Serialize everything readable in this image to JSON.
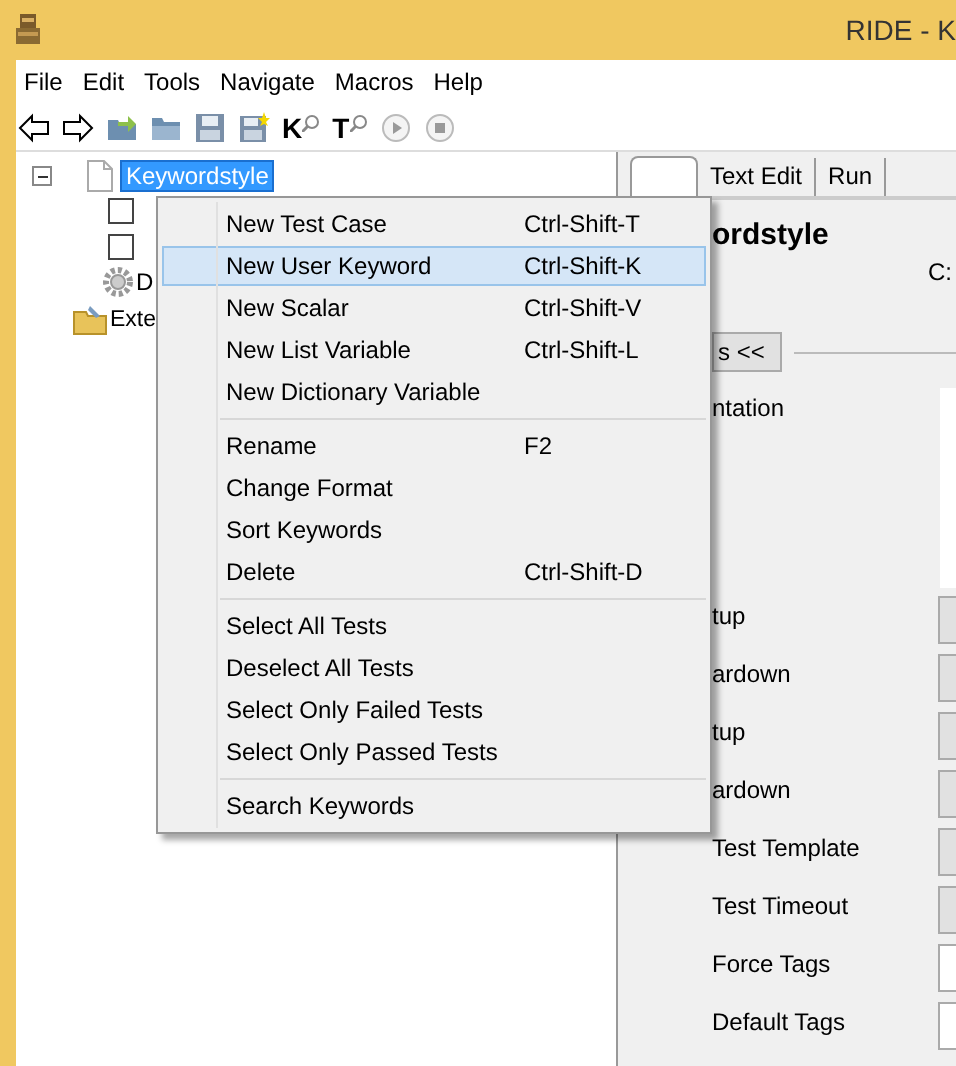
{
  "window": {
    "title": "RIDE - K"
  },
  "menu_bar": [
    "File",
    "Edit",
    "Tools",
    "Navigate",
    "Macros",
    "Help"
  ],
  "toolbar": [
    {
      "kind": "back"
    },
    {
      "kind": "forward"
    },
    {
      "kind": "open-dir"
    },
    {
      "kind": "folder"
    },
    {
      "kind": "save"
    },
    {
      "kind": "save-all"
    },
    {
      "kind": "search",
      "label": "K"
    },
    {
      "kind": "search",
      "label": "T"
    },
    {
      "kind": "play"
    },
    {
      "kind": "stop"
    }
  ],
  "tree": {
    "label": "Keywordstyle",
    "selected": true,
    "expanded": true,
    "children": [
      {
        "kind": "test",
        "checked": false
      },
      {
        "kind": "test",
        "checked": false
      },
      {
        "kind": "resource",
        "label": "D"
      }
    ]
  },
  "tree_extra": {
    "label": "Exte"
  },
  "context_menu": {
    "groups": [
      [
        {
          "label": "New Test Case",
          "shortcut": "Ctrl-Shift-T",
          "selected": false
        },
        {
          "label": "New User Keyword",
          "shortcut": "Ctrl-Shift-K",
          "selected": true
        },
        {
          "label": "New Scalar",
          "shortcut": "Ctrl-Shift-V",
          "selected": false
        },
        {
          "label": "New List Variable",
          "shortcut": "Ctrl-Shift-L",
          "selected": false
        },
        {
          "label": "New Dictionary Variable",
          "selected": false
        }
      ],
      [
        {
          "label": "Rename",
          "shortcut": "F2",
          "selected": false
        },
        {
          "label": "Change Format",
          "selected": false
        },
        {
          "label": "Sort Keywords",
          "selected": false
        },
        {
          "label": "Delete",
          "shortcut": "Ctrl-Shift-D",
          "selected": false
        }
      ],
      [
        {
          "label": "Select All Tests",
          "selected": false
        },
        {
          "label": "Deselect All Tests",
          "selected": false
        },
        {
          "label": "Select Only Failed Tests",
          "selected": false
        },
        {
          "label": "Select Only Passed Tests",
          "selected": false
        }
      ],
      [
        {
          "label": "Search Keywords",
          "selected": false
        }
      ]
    ]
  },
  "editor": {
    "tabs": [
      {
        "selected": true
      },
      {
        "label": "Text Edit",
        "selected": false
      },
      {
        "label": "Run",
        "selected": false
      }
    ],
    "heading": "ordstyle",
    "source": "C:",
    "toggle_button": "s <<",
    "settings": [
      {
        "label": "ntation",
        "kind": "text-area"
      },
      {
        "label": "tup",
        "kind": "button"
      },
      {
        "label": "ardown",
        "kind": "button"
      },
      {
        "label": "tup",
        "kind": "button"
      },
      {
        "label": "ardown",
        "kind": "button"
      },
      {
        "label": "Test Template",
        "kind": "button"
      },
      {
        "label": "Test Timeout",
        "kind": "button"
      },
      {
        "label": "Force Tags",
        "kind": "text"
      },
      {
        "label": "Default Tags",
        "kind": "text"
      }
    ]
  }
}
